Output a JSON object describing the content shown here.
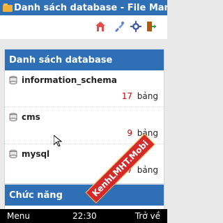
{
  "window": {
    "title": "Danh sách database - File Manag..."
  },
  "toolbar": {
    "icons": [
      "home-icon",
      "tools-icon",
      "gear-icon",
      "exit-icon"
    ]
  },
  "database_panel": {
    "header": "Danh sách database",
    "items": [
      {
        "name": "information_schema",
        "count": "17",
        "unit": "bảng"
      },
      {
        "name": "cms",
        "count": "9",
        "unit": "bảng"
      },
      {
        "name": "mysql",
        "count": "17",
        "unit": "bảng"
      }
    ]
  },
  "function_panel": {
    "header": "Chức năng"
  },
  "bottom_bar": {
    "left": "Menu",
    "time": "22:30",
    "right": "Trở về"
  },
  "watermark": {
    "text": "KenhLMHT.Mobi"
  },
  "colors": {
    "primary": "#2f6fb5",
    "count": "#d10000",
    "background": "#e9e9e9"
  }
}
